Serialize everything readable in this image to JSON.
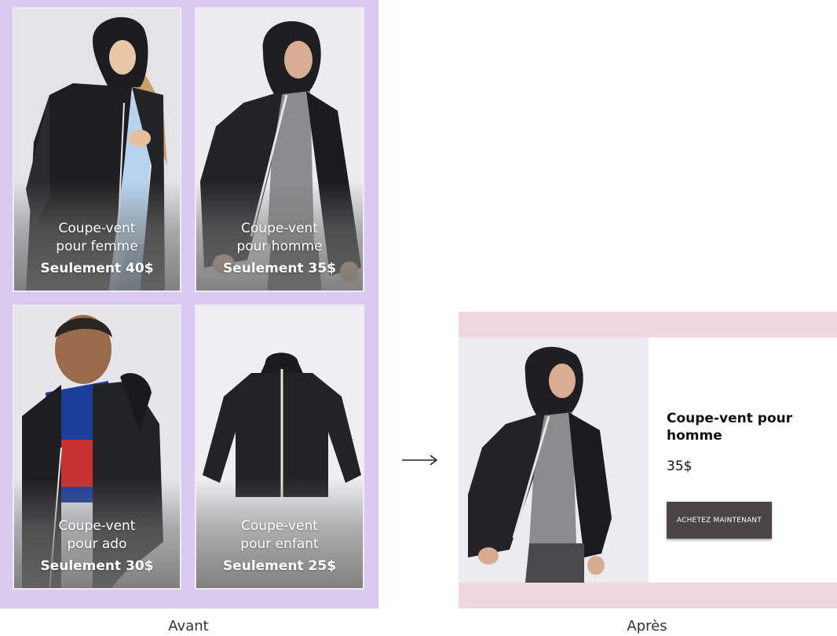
{
  "before": {
    "caption": "Avant",
    "cards": [
      {
        "icon": "woman-windbreaker-photo",
        "name": "Coupe-vent pour femme",
        "price": "Seulement 40$"
      },
      {
        "icon": "man-windbreaker-photo",
        "name": "Coupe-vent pour homme",
        "price": "Seulement 35$"
      },
      {
        "icon": "teen-windbreaker-photo",
        "name": "Coupe-vent pour ado",
        "price": "Seulement 30$"
      },
      {
        "icon": "kid-windbreaker-photo",
        "name": "Coupe-vent pour enfant",
        "price": "Seulement 25$"
      }
    ]
  },
  "arrow": {
    "icon": "right-arrow-icon"
  },
  "after": {
    "caption": "Après",
    "product_title": "Coupe-vent pour homme",
    "price": "35$",
    "cta_label": "ACHETEZ MAINTENANT",
    "icon": "man-windbreaker-photo"
  },
  "colors": {
    "before_background": "#d9c8f0",
    "after_band": "#f0d6de",
    "cta_background": "#4a4446",
    "card_border": "#efeaf6"
  }
}
